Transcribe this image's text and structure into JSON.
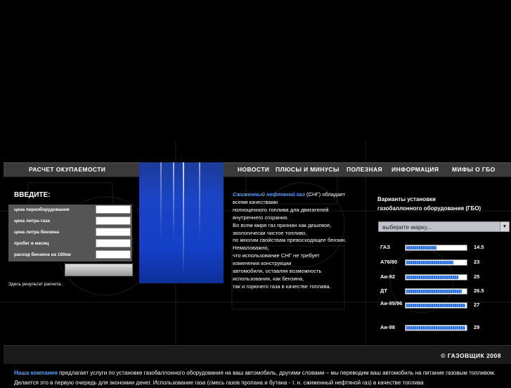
{
  "nav": {
    "left_item": "РАСЧЕТ ОКУПАЕМОСТИ",
    "items": [
      "НОВОСТИ",
      "ПЛЮСЫ И МИНУСЫ",
      "ПОЛЕЗНАЯ",
      "ИНФОРМАЦИЯ",
      "МИФЫ О ГБО"
    ]
  },
  "calculator": {
    "title": "ВВЕДИТЕ:",
    "fields": [
      {
        "label": "цена переоборудования",
        "value": ""
      },
      {
        "label": "цена литра газа",
        "value": ""
      },
      {
        "label": "цена литра бензина",
        "value": ""
      },
      {
        "label": "пробег в месяц",
        "value": ""
      },
      {
        "label": "расход бензина на 100км",
        "value": ""
      }
    ],
    "button_label": "",
    "result_text": "Здесь результат расчета.."
  },
  "info": {
    "highlight": "Сжиженный нефтяной газ",
    "lines": [
      " (СНГ) обладает",
      "всеми качествами",
      "полноценного топлива для двигателей",
      "внутреннего сгорания.",
      "Во всем мире газ признан как дешевое,",
      "экологически чистое топливо,",
      "по многим свойствам превосходящее бензин.",
      "Немаловажно,",
      "что использование СНГ не требует",
      "изменения конструкции",
      "автомобиля, оставляя возможность",
      "использования, как бензина,",
      "так и горючего газа в качестве топлива."
    ]
  },
  "variants": {
    "title_line1": "Варианты установки",
    "title_line2": "газобаллонного оборудования (ГБО)",
    "select_value": "выберите марку...",
    "fuels": [
      {
        "name": "ГАЗ",
        "value": "14.5",
        "fill": 0.5
      },
      {
        "name": "А76/80",
        "value": "23",
        "fill": 0.78
      },
      {
        "name": "Аи-92",
        "value": "25",
        "fill": 0.86
      },
      {
        "name": "ДТ",
        "value": "26.5",
        "fill": 0.92
      },
      {
        "name": "Аи-95/96",
        "value": "27",
        "fill": 0.98
      },
      {
        "name": "Аи-98",
        "value": "29",
        "fill": 0.98
      }
    ]
  },
  "footer": {
    "copyright": "© ГАЗОВЩИК 2008",
    "company_link": "Наша компания",
    "company_text": " предлагает услуги по установке газобаллонного оборудования на ваш автомобиль, другими словами – мы переводим ваш автомобиль на питание газовым топливом. Делается это в первую очередь для экономии денег. Использование газа (смесь газов пропана и бутана - т. н. сжиженный нефтяной газ) в качестве топлива"
  }
}
